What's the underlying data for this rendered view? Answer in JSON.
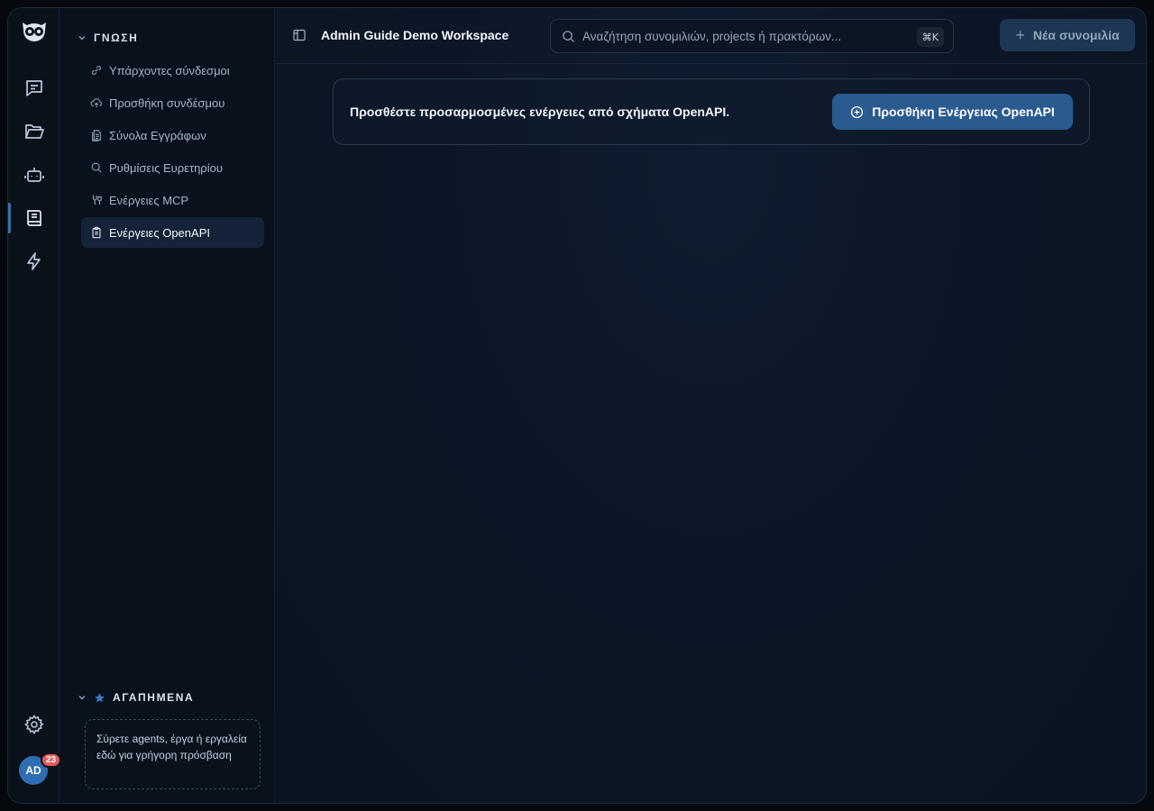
{
  "app": {
    "logo_icon": "owl-logo-icon",
    "accent_color": "#2a5a8f"
  },
  "rail": {
    "items": [
      {
        "name": "chat",
        "icon": "chat-bubble-icon"
      },
      {
        "name": "projects",
        "icon": "folder-open-icon"
      },
      {
        "name": "agents",
        "icon": "robot-icon"
      },
      {
        "name": "knowledge",
        "icon": "book-icon",
        "active": true
      },
      {
        "name": "actions",
        "icon": "lightning-icon"
      }
    ],
    "settings_icon": "gear-icon",
    "avatar_initials": "AD",
    "notification_count": "23"
  },
  "sidebar": {
    "section_title": "ΓΝΩΣΗ",
    "items": [
      {
        "label": "Υπάρχοντες σύνδεσμοι",
        "icon": "link-icon"
      },
      {
        "label": "Προσθήκη συνδέσμου",
        "icon": "cloud-upload-icon"
      },
      {
        "label": "Σύνολα Εγγράφων",
        "icon": "documents-icon"
      },
      {
        "label": "Ρυθμίσεις Ευρετηρίου",
        "icon": "search-icon"
      },
      {
        "label": "Ενέργειες MCP",
        "icon": "plug-icon"
      },
      {
        "label": "Ενέργειες OpenAPI",
        "icon": "clipboard-icon",
        "active": true
      }
    ],
    "favorites_title": "ΑΓΑΠΗΜΕΝΑ",
    "favorites_hint": "Σύρετε agents, έργα ή εργαλεία εδώ για γρήγορη πρόσβαση"
  },
  "header": {
    "workspace_title": "Admin Guide Demo Workspace",
    "search_placeholder": "Αναζήτηση συνομιλιών, projects ή πρακτόρων...",
    "shortcut": "⌘K",
    "new_chat_label": "Νέα συνομιλία"
  },
  "main": {
    "card_text": "Προσθέστε προσαρμοσμένες ενέργειες από σχήματα OpenAPI.",
    "card_button_label": "Προσθήκη Ενέργειας OpenAPI"
  }
}
